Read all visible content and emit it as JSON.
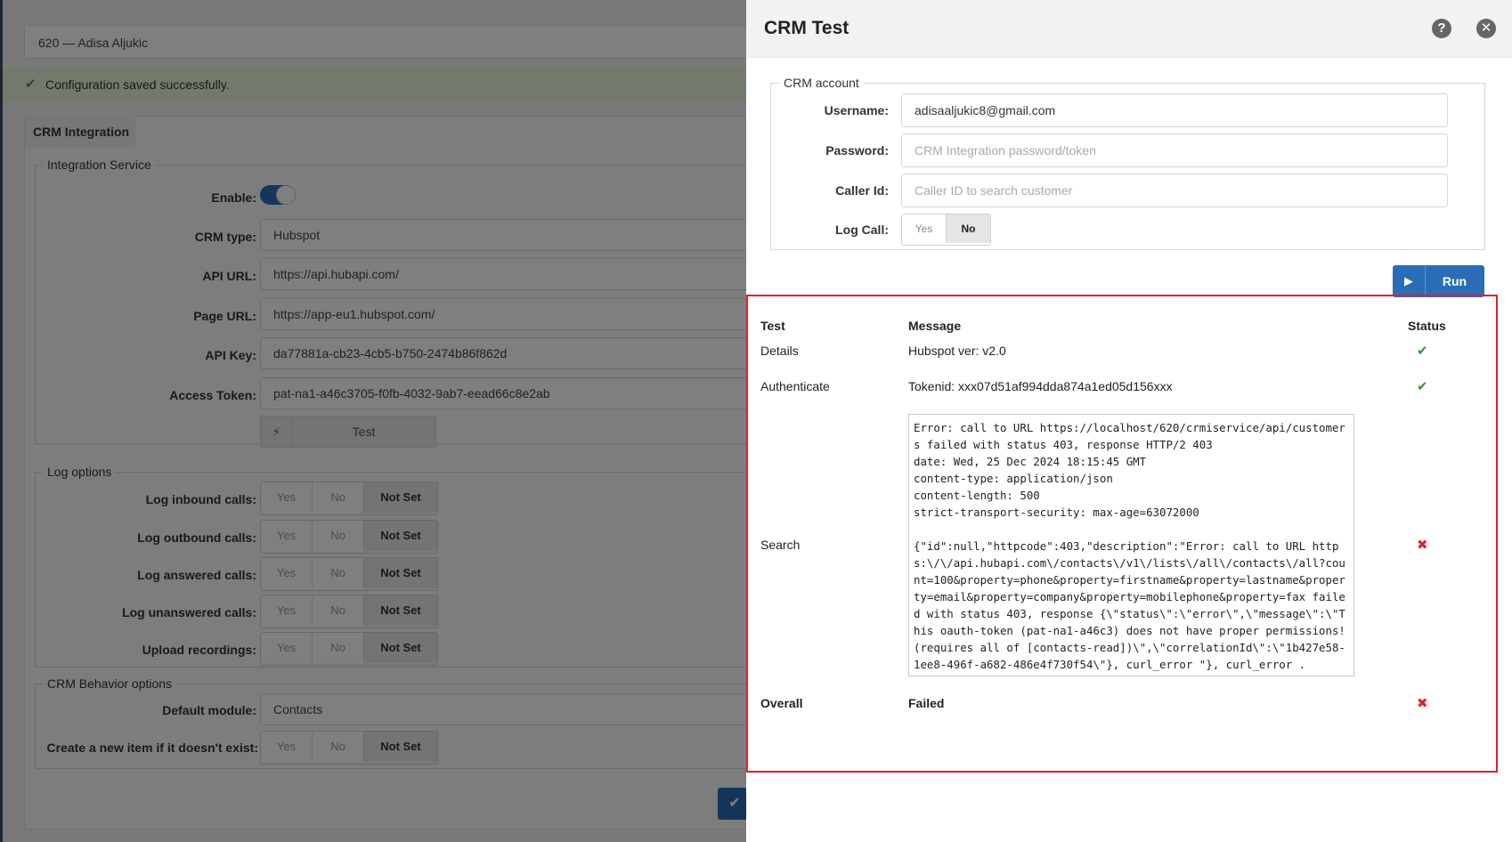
{
  "background": {
    "record_title": "620  —  Adisa Aljukic",
    "success_message": "Configuration saved successfully.",
    "tab_label": "CRM Integration",
    "integration_service": {
      "legend": "Integration Service",
      "enable_label": "Enable:",
      "crm_type_label": "CRM type:",
      "crm_type_value": "Hubspot",
      "api_url_label": "API URL:",
      "api_url_value": "https://api.hubapi.com/",
      "page_url_label": "Page URL:",
      "page_url_value": "https://app-eu1.hubspot.com/",
      "api_key_label": "API Key:",
      "api_key_value": "da77881a-cb23-4cb5-b750-2474b86f862d",
      "access_token_label": "Access Token:",
      "access_token_value": "pat-na1-a46c3705-f0fb-4032-9ab7-eead66c8e2ab",
      "test_button": "Test"
    },
    "log_options": {
      "legend": "Log options",
      "yes": "Yes",
      "no": "No",
      "not_set": "Not Set",
      "rows": [
        "Log inbound calls:",
        "Log outbound calls:",
        "Log answered calls:",
        "Log unanswered calls:",
        "Upload recordings:"
      ]
    },
    "behavior": {
      "legend": "CRM Behavior options",
      "default_module_label": "Default module:",
      "default_module_value": "Contacts",
      "create_new_label": "Create a new item if it doesn't exist:"
    }
  },
  "modal": {
    "title": "CRM Test",
    "account": {
      "legend": "CRM account",
      "username_label": "Username:",
      "username_value": "adisaaljukic8@gmail.com",
      "password_label": "Password:",
      "password_placeholder": "CRM Integration password/token",
      "caller_id_label": "Caller Id:",
      "caller_id_placeholder": "Caller ID to search customer",
      "log_call_label": "Log Call:",
      "log_call_yes": "Yes",
      "log_call_no": "No"
    },
    "run_button": "Run",
    "results": {
      "headers": {
        "test": "Test",
        "message": "Message",
        "status": "Status"
      },
      "rows": [
        {
          "test": "Details",
          "message": "Hubspot ver: v2.0",
          "status": "ok"
        },
        {
          "test": "Authenticate",
          "message": "Tokenid: xxx07d51af994dda874a1ed05d156xxx",
          "status": "ok"
        },
        {
          "test": "Search",
          "message": "Error: call to URL https://localhost/620/crmiservice/api/customers failed with status 403, response HTTP/2 403\ndate: Wed, 25 Dec 2024 18:15:45 GMT\ncontent-type: application/json\ncontent-length: 500\nstrict-transport-security: max-age=63072000\n\n{\"id\":null,\"httpcode\":403,\"description\":\"Error: call to URL https:\\/\\/api.hubapi.com\\/contacts\\/v1\\/lists\\/all\\/contacts\\/all?count=100&property=phone&property=firstname&property=lastname&property=email&property=company&property=mobilephone&property=fax failed with status 403, response {\\\"status\\\":\\\"error\\\",\\\"message\\\":\\\"This oauth-token (pat-na1-a46c3) does not have proper permissions! (requires all of [contacts-read])\\\",\\\"correlationId\\\":\\\"1b427e58-1ee8-496f-a682-486e4f730f54\\\"}, curl_error \"}, curl_error .",
          "status": "fail"
        },
        {
          "test": "Overall",
          "message": "Failed",
          "status": "fail"
        }
      ]
    },
    "status_glyphs": {
      "ok": "✔",
      "fail": "✖"
    },
    "colors": {
      "accent": "#2a6db6",
      "ok": "#2e9a2e",
      "fail": "#e0212b",
      "highlight_border": "#e0212b"
    }
  }
}
